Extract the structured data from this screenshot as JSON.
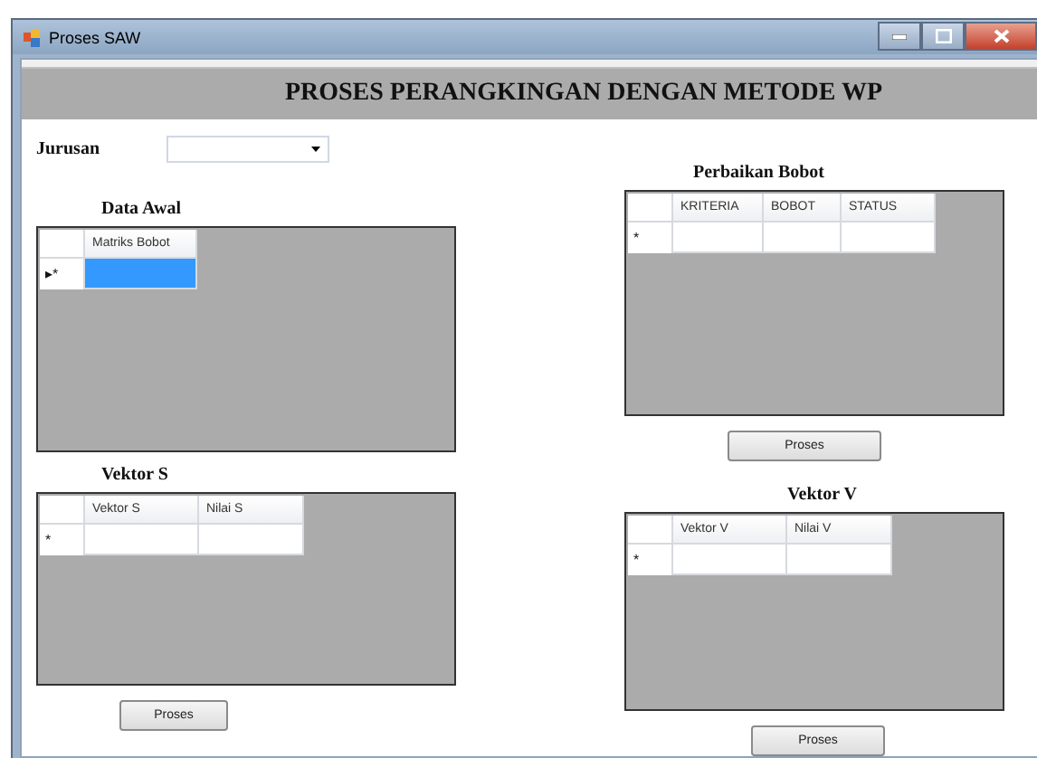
{
  "window": {
    "title": "Proses SAW"
  },
  "header": {
    "title": "PROSES PERANGKINGAN DENGAN METODE WP"
  },
  "jurusan": {
    "label": "Jurusan"
  },
  "grids": [
    {
      "title": "Data Awal",
      "columns": [
        "Matriks Bobot"
      ],
      "rows": [
        {
          "marker": "▸*",
          "cells": [
            {
              "selected": true
            }
          ]
        }
      ]
    },
    {
      "title": "Perbaikan Bobot",
      "columns": [
        "KRITERIA",
        "BOBOT",
        "STATUS"
      ],
      "rows": [
        {
          "marker": "*",
          "cells": [
            {
              "selected": false
            },
            {
              "selected": false
            },
            {
              "selected": false
            }
          ]
        }
      ],
      "button": "Proses"
    },
    {
      "title": "Vektor S",
      "columns": [
        "Vektor S",
        "Nilai S"
      ],
      "rows": [
        {
          "marker": "*",
          "cells": [
            {
              "selected": false
            },
            {
              "selected": false
            }
          ]
        }
      ],
      "button": "Proses"
    },
    {
      "title": "Vektor V",
      "columns": [
        "Vektor V",
        "Nilai V"
      ],
      "rows": [
        {
          "marker": "*",
          "cells": [
            {
              "selected": false
            },
            {
              "selected": false
            }
          ]
        }
      ],
      "button": "Proses"
    }
  ]
}
